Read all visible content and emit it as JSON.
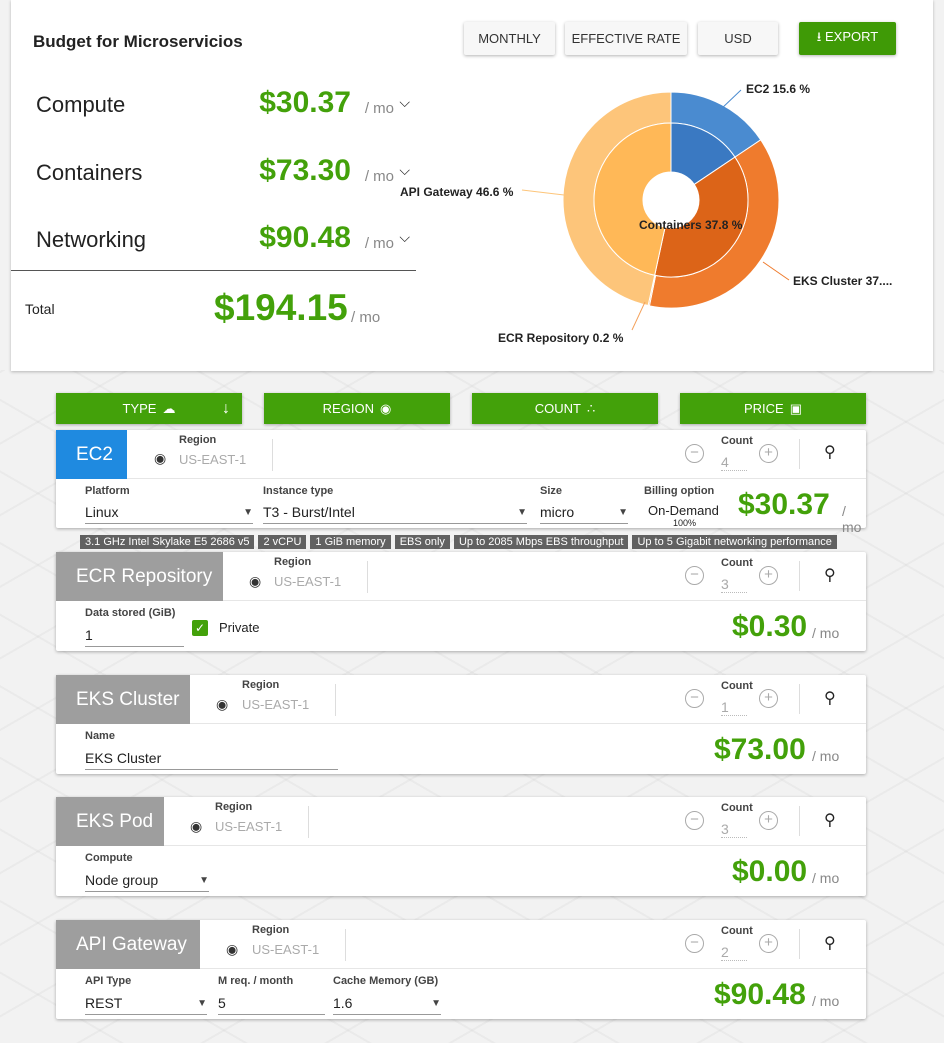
{
  "summary": {
    "title": "Budget for Microservicios",
    "buttons": {
      "monthly": "MONTHLY",
      "rate": "EFFECTIVE RATE",
      "currency": "USD",
      "export": "EXPORT"
    },
    "rows": [
      {
        "label": "Compute",
        "amount": "$30.37",
        "unit": "/ mo"
      },
      {
        "label": "Containers",
        "amount": "$73.30",
        "unit": "/ mo"
      },
      {
        "label": "Networking",
        "amount": "$90.48",
        "unit": "/ mo"
      }
    ],
    "total_label": "Total",
    "total_amount": "$194.15",
    "total_unit": "/ mo"
  },
  "chart_data": {
    "type": "pie",
    "slices": [
      {
        "label": "EC2 15.6 %",
        "value": 15.6,
        "color": "#4a8bd0"
      },
      {
        "label": "EKS Cluster 37....",
        "value": 37.6,
        "color": "#ef7b2d"
      },
      {
        "label": "ECR Repository 0.2 %",
        "value": 0.2,
        "color": "#f4a15b"
      },
      {
        "label": "API Gateway 46.6 %",
        "value": 46.6,
        "color": "#fdc57a"
      }
    ],
    "inner": [
      {
        "label": "Compute",
        "value": 15.6,
        "color": "#3a79c2"
      },
      {
        "label": "Containers 37.8 %",
        "value": 37.8,
        "color": "#dc6418"
      },
      {
        "label": "Networking",
        "value": 46.6,
        "color": "#ffb857"
      }
    ]
  },
  "headers": {
    "type": "TYPE",
    "region": "REGION",
    "count": "COUNT",
    "price": "PRICE"
  },
  "region_label": "Region",
  "count_label": "Count",
  "price_unit": "/ mo",
  "cards": {
    "ec2": {
      "name": "EC2",
      "region": "US-EAST-1",
      "count": "4",
      "platform_label": "Platform",
      "platform": "Linux",
      "instance_label": "Instance type",
      "instance": "T3 - Burst/Intel",
      "size_label": "Size",
      "size": "micro",
      "billing_label": "Billing option",
      "billing": "On-Demand",
      "billing_pct": "100%",
      "price": "$30.37",
      "chips": [
        "3.1 GHz Intel Skylake E5 2686 v5",
        "2 vCPU",
        "1 GiB memory",
        "EBS only",
        "Up to 2085 Mbps EBS throughput",
        "Up to 5 Gigabit networking performance"
      ]
    },
    "ecr": {
      "name": "ECR Repository",
      "region": "US-EAST-1",
      "count": "3",
      "data_label": "Data stored (GiB)",
      "data": "1",
      "private_label": "Private",
      "price": "$0.30"
    },
    "eks": {
      "name": "EKS Cluster",
      "region": "US-EAST-1",
      "count": "1",
      "name_label": "Name",
      "name_val": "EKS Cluster",
      "price": "$73.00"
    },
    "pod": {
      "name": "EKS Pod",
      "region": "US-EAST-1",
      "count": "3",
      "compute_label": "Compute",
      "compute": "Node group",
      "price": "$0.00"
    },
    "api": {
      "name": "API Gateway",
      "region": "US-EAST-1",
      "count": "2",
      "type_label": "API Type",
      "type": "REST",
      "req_label": "M req. / month",
      "req": "5",
      "cache_label": "Cache Memory (GB)",
      "cache": "1.6",
      "price": "$90.48"
    }
  }
}
